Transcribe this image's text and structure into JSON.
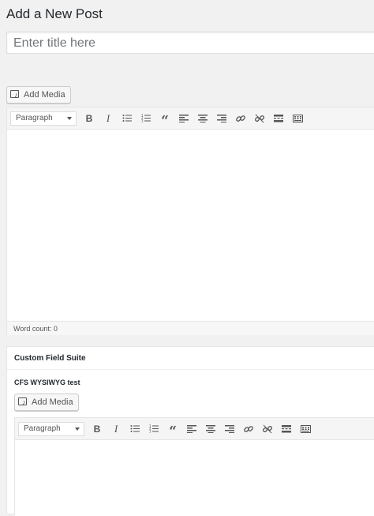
{
  "page": {
    "title": "Add a New Post"
  },
  "post_title": {
    "placeholder": "Enter title here",
    "value": ""
  },
  "main_editor": {
    "add_media_label": "Add Media",
    "format_select": "Paragraph",
    "toolbar_buttons": [
      "bold-icon",
      "italic-icon",
      "bulleted-list-icon",
      "numbered-list-icon",
      "blockquote-icon",
      "align-left-icon",
      "align-center-icon",
      "align-right-icon",
      "link-icon",
      "unlink-icon",
      "read-more-icon",
      "toolbar-toggle-icon"
    ],
    "word_count": "Word count: 0"
  },
  "custom_fields": {
    "box_title": "Custom Field Suite",
    "field_label": "CFS WYSIWYG test",
    "add_media_label": "Add Media",
    "format_select": "Paragraph"
  }
}
